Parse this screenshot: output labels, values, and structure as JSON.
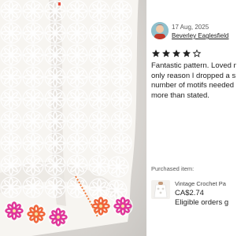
{
  "photo": {
    "alt_icon": "crochet-blanket-photo"
  },
  "review": {
    "date": "17 Aug, 2025",
    "reviewer_name": "Beverley Eaglesfield",
    "rating": 4,
    "rating_max": 5,
    "text_lines": [
      "Fantastic pattern. Loved m",
      "only reason I dropped a s",
      "number of motifs needed",
      "more than stated."
    ]
  },
  "purchased": {
    "label": "Purchased item:",
    "item_title": "Vintage Crochet Pa",
    "price": "CA$2.74",
    "note": "Eligible orders g"
  },
  "colors": {
    "star": "#222222",
    "motif_pink": "#e0369a",
    "motif_orange": "#f0653a",
    "yarn": "#fbfaf7"
  }
}
